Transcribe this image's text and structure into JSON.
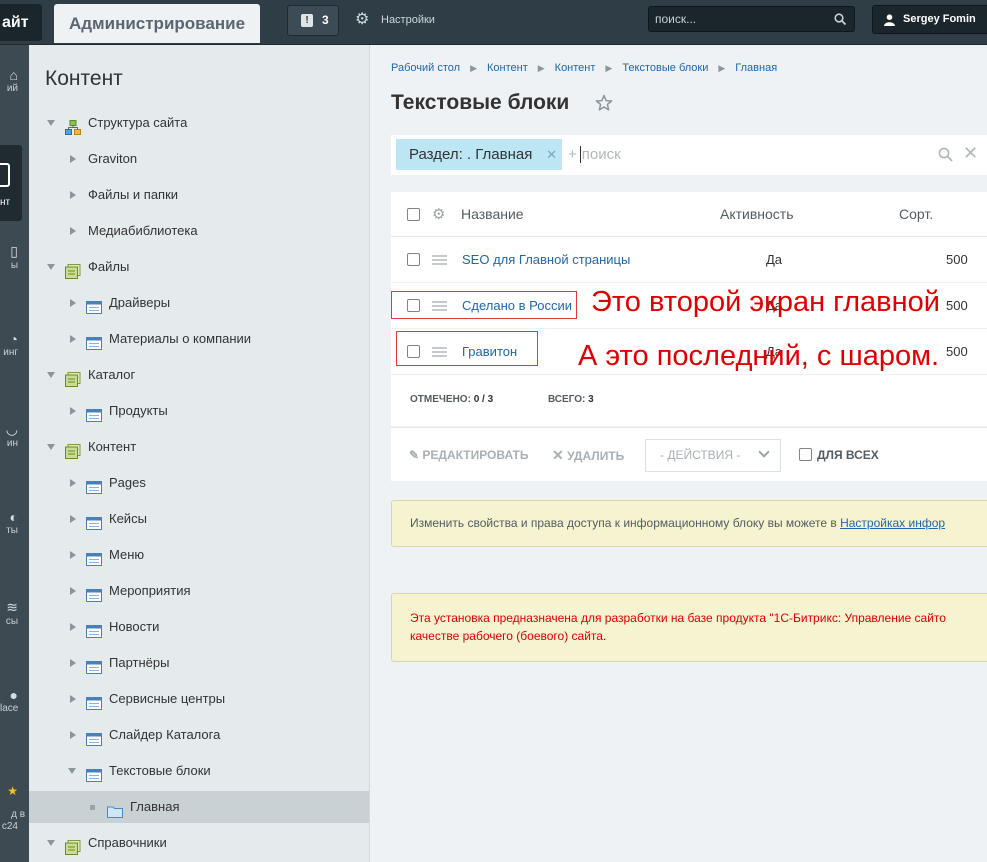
{
  "topbar": {
    "site_label": "айт",
    "admin_tab": "Администрирование",
    "notifications_count": "3",
    "settings_label": "Настройки",
    "search_placeholder": "поиск...",
    "user_name": "Sergey Fomin"
  },
  "left_strip": {
    "items": [
      {
        "icon": "desktop-icon",
        "label": "ий"
      },
      {
        "icon": "content-icon",
        "label": "нт",
        "active": true
      },
      {
        "icon": "pages-icon",
        "label": "ы"
      },
      {
        "icon": "marketing-icon",
        "label": "инг"
      },
      {
        "icon": "shop-icon",
        "label": "ин"
      },
      {
        "icon": "services-icon",
        "label": "ты"
      },
      {
        "icon": "layers-icon",
        "label": "сы"
      },
      {
        "icon": "marketplace-icon",
        "label": "lace"
      },
      {
        "icon": "bitrix24-icon",
        "label": "д в\nс24"
      }
    ]
  },
  "sidebar": {
    "title": "Контент",
    "tree": [
      {
        "label": "Структура сайта",
        "level": 0,
        "state": "open",
        "icon": "structure-icon"
      },
      {
        "label": "Graviton",
        "level": 1,
        "state": "closed",
        "icon": ""
      },
      {
        "label": "Файлы и папки",
        "level": 1,
        "state": "closed",
        "icon": ""
      },
      {
        "label": "Медиабиблиотека",
        "level": 1,
        "state": "closed",
        "icon": ""
      },
      {
        "label": "Файлы",
        "level": 0,
        "state": "open",
        "icon": "iblock-type-icon"
      },
      {
        "label": "Драйверы",
        "level": 1,
        "state": "closed",
        "icon": "iblock-icon"
      },
      {
        "label": "Материалы о компании",
        "level": 1,
        "state": "closed",
        "icon": "iblock-icon"
      },
      {
        "label": "Каталог",
        "level": 0,
        "state": "open",
        "icon": "iblock-type-icon"
      },
      {
        "label": "Продукты",
        "level": 1,
        "state": "closed",
        "icon": "iblock-icon"
      },
      {
        "label": "Контент",
        "level": 0,
        "state": "open",
        "icon": "iblock-type-icon"
      },
      {
        "label": "Pages",
        "level": 1,
        "state": "closed",
        "icon": "iblock-icon"
      },
      {
        "label": "Кейсы",
        "level": 1,
        "state": "closed",
        "icon": "iblock-icon"
      },
      {
        "label": "Меню",
        "level": 1,
        "state": "closed",
        "icon": "iblock-icon"
      },
      {
        "label": "Мероприятия",
        "level": 1,
        "state": "closed",
        "icon": "iblock-icon"
      },
      {
        "label": "Новости",
        "level": 1,
        "state": "closed",
        "icon": "iblock-icon"
      },
      {
        "label": "Партнёры",
        "level": 1,
        "state": "closed",
        "icon": "iblock-icon"
      },
      {
        "label": "Сервисные центры",
        "level": 1,
        "state": "closed",
        "icon": "iblock-icon"
      },
      {
        "label": "Слайдер Каталога",
        "level": 1,
        "state": "closed",
        "icon": "iblock-icon"
      },
      {
        "label": "Текстовые блоки",
        "level": 1,
        "state": "open",
        "icon": "iblock-icon"
      },
      {
        "label": "Главная",
        "level": 2,
        "state": "leaf",
        "icon": "folder-icon",
        "selected": true
      },
      {
        "label": "Справочники",
        "level": 0,
        "state": "open",
        "icon": "iblock-type-icon"
      }
    ]
  },
  "main": {
    "breadcrumb": [
      "Рабочий стол",
      "Контент",
      "Контент",
      "Текстовые блоки",
      "Главная"
    ],
    "title": "Текстовые блоки",
    "filter": {
      "chip": "Раздел: . Главная",
      "placeholder": "+ поиск"
    },
    "grid": {
      "columns": {
        "name": "Название",
        "activity": "Активность",
        "sort": "Сорт."
      },
      "rows": [
        {
          "name": "SEO для Главной страницы",
          "active": "Да",
          "sort": "500"
        },
        {
          "name": "Сделано в России",
          "active": "Да",
          "sort": "500"
        },
        {
          "name": "Гравитон",
          "active": "Да",
          "sort": "500"
        }
      ],
      "selected_label": "ОТМЕЧЕНО:",
      "selected_value": "0 / 3",
      "total_label": "ВСЕГО:",
      "total_value": "3"
    },
    "actions": {
      "edit": "РЕДАКТИРОВАТЬ",
      "delete": "УДАЛИТЬ",
      "select": "- ДЕЙСТВИЯ -",
      "for_all": "ДЛЯ ВСЕХ"
    },
    "notice_info": {
      "text": "Изменить свойства и права доступа к информационному блоку вы можете в ",
      "link": "Настройках инфор"
    },
    "notice_warning": {
      "line1": "Эта установка предназначена для разработки на базе продукта \"1С-Битрикс: Управление сайто",
      "line2": "качестве рабочего (боевого) сайта."
    }
  },
  "annotations": {
    "first": "Это второй экран главной",
    "second": "А это последний, с шаром.",
    "color": "#e10000"
  },
  "colors": {
    "topbar": "#2f3d47",
    "link": "#2067b0",
    "chip": "#bde6f4",
    "notice_bg": "#f6f3d0",
    "warning_text": "#dd0000"
  }
}
